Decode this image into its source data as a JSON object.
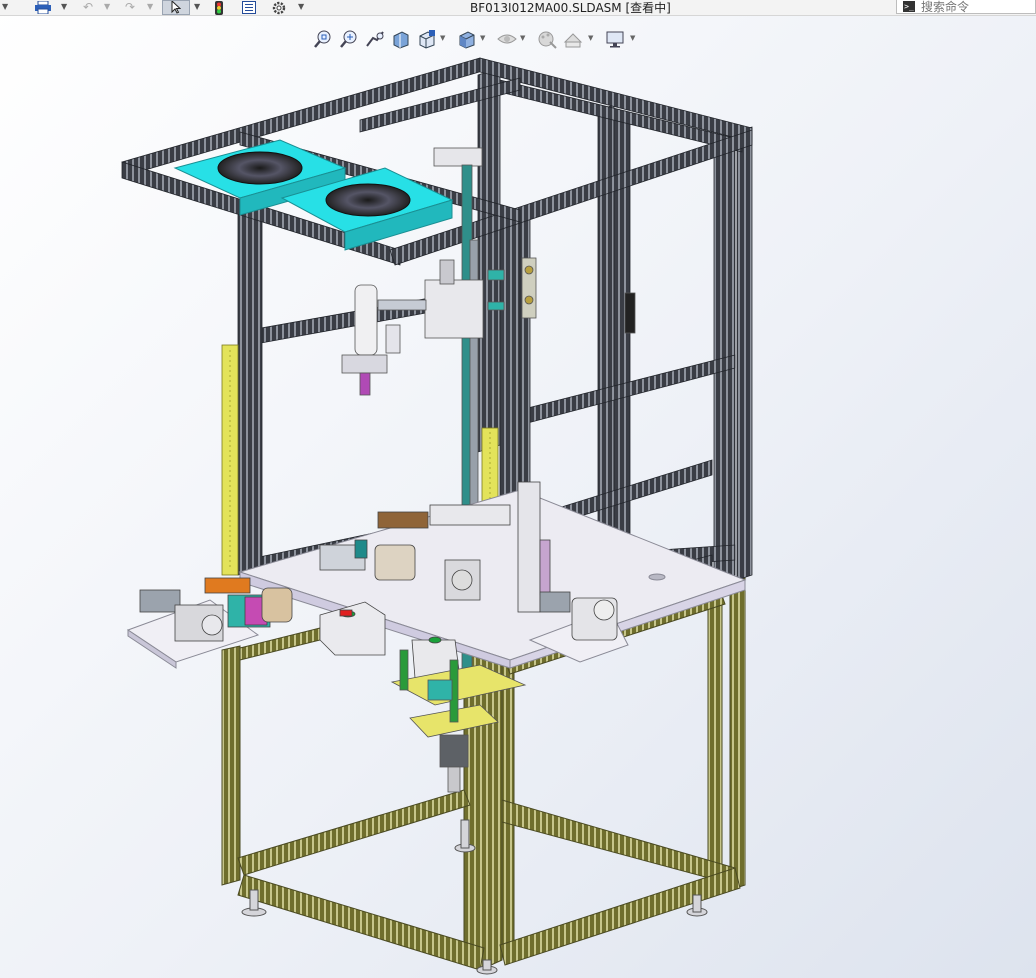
{
  "window": {
    "title": "BF013I012MA00.SLDASM [查看中]"
  },
  "search": {
    "placeholder": "搜索命令"
  },
  "toolbar": {
    "icons": [
      "dropdown-arrow",
      "print-icon",
      "undo-icon",
      "redo-icon",
      "select-icon",
      "rebuild-icon",
      "file-properties-icon",
      "options-icon"
    ]
  },
  "view_toolbar": {
    "icons": [
      "zoom-to-fit-icon",
      "zoom-to-area-icon",
      "previous-view-icon",
      "section-view-icon",
      "view-orientation-icon",
      "display-style-icon",
      "hide-show-items-icon",
      "edit-appearance-icon",
      "apply-scene-icon",
      "view-settings-icon"
    ]
  },
  "colors": {
    "frame_dark": "#3a3d45",
    "frame_light": "#9aa0ab",
    "frame_olive": "#8a8a3a",
    "fan_panel": "#27e0e6",
    "table_top": "#ecebf2",
    "light_curtain": "#e3e35a",
    "accent_teal": "#2fb3a8",
    "accent_magenta": "#c54bb3",
    "accent_orange": "#e07a1f"
  }
}
